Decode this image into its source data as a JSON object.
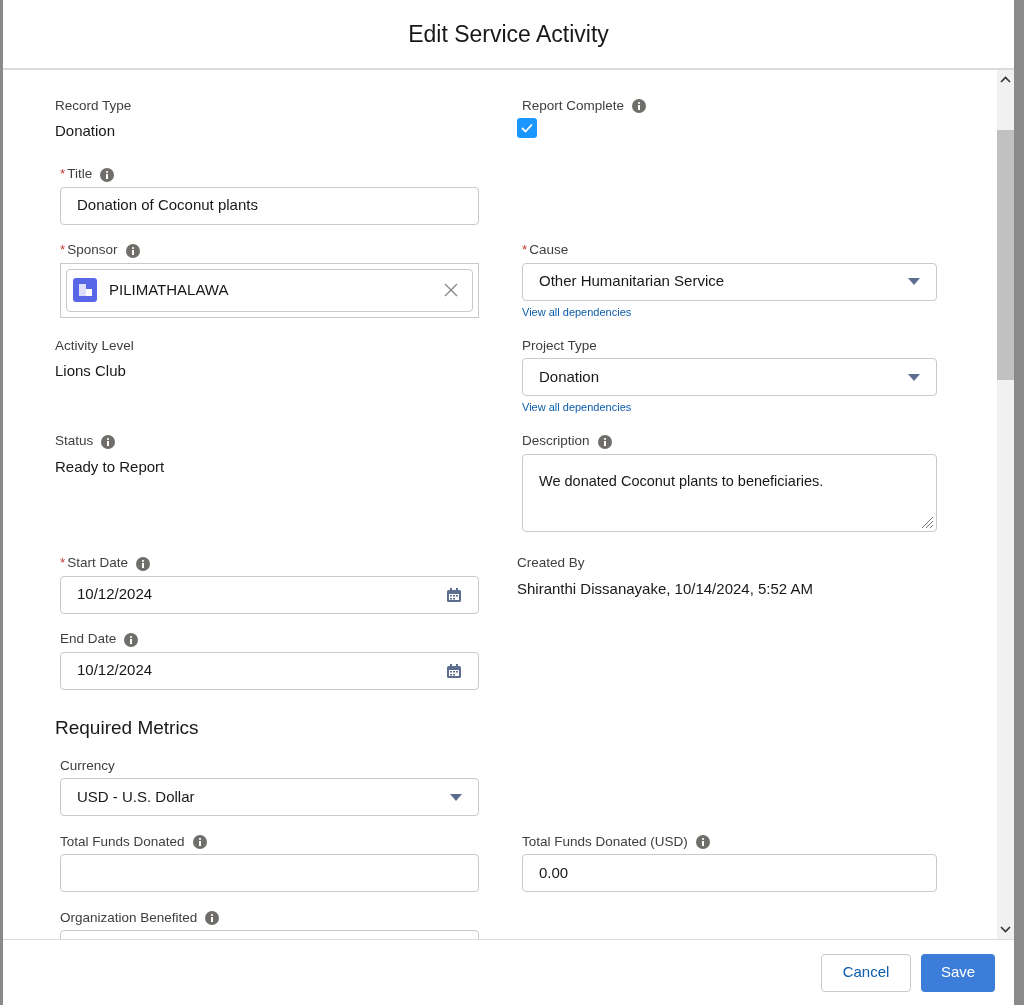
{
  "modal": {
    "title": "Edit Service Activity"
  },
  "rows": [
    [
      {
        "kind": "readonly",
        "label": "Record Type",
        "value": "Donation"
      },
      {
        "kind": "checkbox",
        "label": "Report Complete",
        "info": true,
        "checked": true
      }
    ],
    [
      {
        "kind": "text",
        "label": "Title",
        "required": "*",
        "info": true,
        "value": "Donation of Coconut plants"
      },
      {
        "kind": "empty"
      }
    ],
    [
      {
        "kind": "lookup",
        "label": "Sponsor",
        "required": "*",
        "info": true,
        "value": "PILIMATHALAWA"
      },
      {
        "kind": "select",
        "label": "Cause",
        "required": "*",
        "value": "Other Humanitarian Service",
        "link": "View all dependencies"
      }
    ],
    [
      {
        "kind": "readonly",
        "label": "Activity Level",
        "value": "Lions Club"
      },
      {
        "kind": "select",
        "label": "Project Type",
        "value": "Donation",
        "link": "View all dependencies"
      }
    ],
    [
      {
        "kind": "readonly",
        "label": "Status",
        "info": true,
        "value": "Ready to Report"
      },
      {
        "kind": "textarea",
        "label": "Description",
        "info": true,
        "value": "We donated Coconut plants to beneficiaries."
      }
    ],
    [
      {
        "kind": "date",
        "label": "Start Date",
        "required": "*",
        "info": true,
        "value": "10/12/2024"
      },
      {
        "kind": "readonly",
        "label": "Created By",
        "value": "Shiranthi Dissanayake, 10/14/2024, 5:52 AM"
      }
    ],
    [
      {
        "kind": "date",
        "label": "End Date",
        "info": true,
        "value": "10/12/2024"
      },
      {
        "kind": "empty"
      }
    ],
    [
      {
        "kind": "heading",
        "label": "Required Metrics"
      },
      {
        "kind": "empty"
      }
    ],
    [
      {
        "kind": "select",
        "label": "Currency",
        "value": "USD - U.S. Dollar"
      },
      {
        "kind": "empty"
      }
    ],
    [
      {
        "kind": "text",
        "label": "Total Funds Donated",
        "info": true
      },
      {
        "kind": "text",
        "label": "Total Funds Donated (USD)",
        "info": true,
        "value": "0.00"
      }
    ],
    [
      {
        "kind": "text",
        "label": "Organization Benefited",
        "info": true
      },
      {
        "kind": "empty"
      }
    ]
  ],
  "footer": {
    "buttons": [
      {
        "label": "Cancel",
        "kind": "neutral"
      },
      {
        "label": "Save",
        "kind": "brand"
      }
    ]
  }
}
